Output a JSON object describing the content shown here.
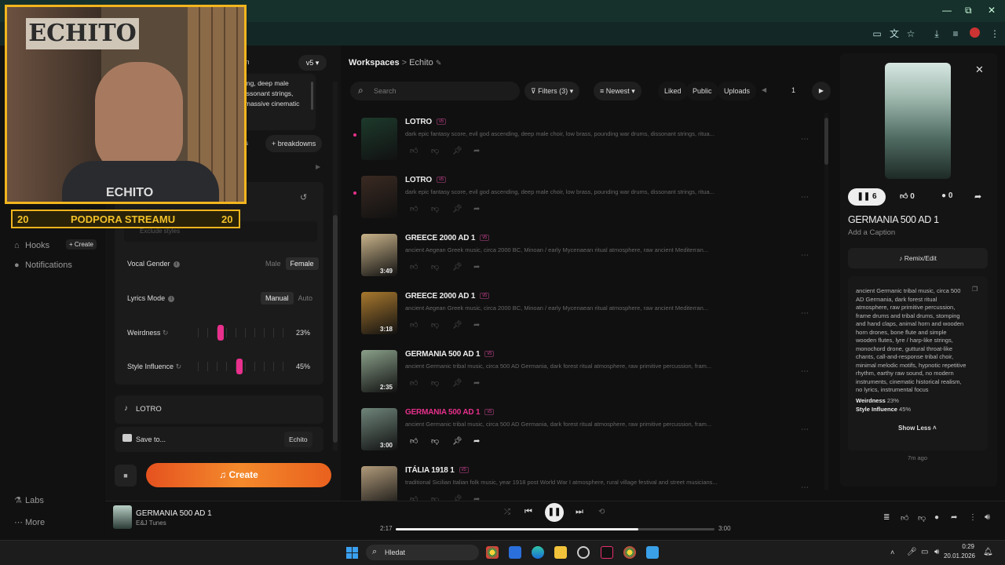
{
  "browser": {
    "window_controls": [
      "—",
      "⧉",
      "✕"
    ]
  },
  "overlay": {
    "webcam_logo": "ECHITO",
    "shirt_text": "ECHITO",
    "banner_left": "20",
    "banner_text": "PODPORA STREAMU",
    "banner_right": "20"
  },
  "leftnav": {
    "hooks": "Hooks",
    "create": "+ Create",
    "notifications": "Notifications",
    "labs": "Labs",
    "more": "More"
  },
  "form": {
    "version": "v5",
    "m_fragment": "m",
    "prompt_snippet": [
      "ing, deep male",
      "issonant strings,",
      "massive cinematic"
    ],
    "tag_chip_s": "s",
    "breakdowns": "+ breakdowns",
    "exclude_styles": "Exclude styles",
    "vocal_gender": "Vocal Gender",
    "male": "Male",
    "female": "Female",
    "lyrics_mode": "Lyrics Mode",
    "manual": "Manual",
    "auto": "Auto",
    "weirdness": "Weirdness",
    "weirdness_val": "23%",
    "weirdness_level": 0.23,
    "style_influence": "Style Influence",
    "style_val": "45%",
    "style_level": 0.45,
    "song_title": "LOTRO",
    "save_to": "Save to...",
    "workspace": "Echito",
    "create": "Create"
  },
  "main": {
    "breadcrumb_root": "Workspaces",
    "breadcrumb_sep": ">",
    "breadcrumb_current": "Echito",
    "search_placeholder": "Search",
    "filters": "Filters (3)",
    "sort": "Newest",
    "liked": "Liked",
    "public": "Public",
    "uploads": "Uploads",
    "page": "1",
    "songs": [
      {
        "title": "LOTRO",
        "badge": "v5",
        "desc": "dark epic fantasy score, evil god ascending, deep male choir, low brass, pounding war drums, dissonant strings, ritua...",
        "dur": "",
        "playing": false,
        "new": true
      },
      {
        "title": "LOTRO",
        "badge": "v5",
        "desc": "dark epic fantasy score, evil god ascending, deep male choir, low brass, pounding war drums, dissonant strings, ritua...",
        "dur": "",
        "playing": false,
        "new": true
      },
      {
        "title": "GREECE 2000 AD 1",
        "badge": "v5",
        "desc": "ancient Aegean Greek music, circa 2000 BC, Minoan / early Mycenaean ritual atmosphere, raw ancient Mediterran...",
        "dur": "3:49",
        "playing": false,
        "new": false
      },
      {
        "title": "GREECE 2000 AD 1",
        "badge": "v5",
        "desc": "ancient Aegean Greek music, circa 2000 BC, Minoan / early Mycenaean ritual atmosphere, raw ancient Mediterran...",
        "dur": "3:18",
        "playing": false,
        "new": false
      },
      {
        "title": "GERMANIA 500 AD 1",
        "badge": "v5",
        "desc": "ancient Germanic tribal music, circa 500 AD Germania, dark forest ritual atmosphere, raw primitive percussion, fram...",
        "dur": "2:35",
        "playing": false,
        "new": false
      },
      {
        "title": "GERMANIA 500 AD 1",
        "badge": "v5",
        "desc": "ancient Germanic tribal music, circa 500 AD Germania, dark forest ritual atmosphere, raw primitive percussion, fram...",
        "dur": "3:00",
        "playing": true,
        "new": false
      },
      {
        "title": "ITÁLIA 1918 1",
        "badge": "v5",
        "desc": "traditional Sicilian Italian folk music, year 1918 post World War I atmosphere, rural village festival and street musicians...",
        "dur": "",
        "playing": false,
        "new": false
      }
    ]
  },
  "detail": {
    "plays": "6",
    "likes": "0",
    "comments": "0",
    "title": "GERMANIA 500 AD 1",
    "caption": "Add a Caption",
    "remix": "Remix/Edit",
    "lyrics": "ancient Germanic tribal music, circa 500 AD Germania, dark forest ritual atmosphere, raw primitive percussion, frame drums and tribal drums, stomping and hand claps, animal horn and wooden horn drones, bone flute and simple wooden flutes, lyre / harp-like strings, monochord drone, guttural throat-like chants, call-and-response tribal choir, minimal melodic motifs, hypnotic repetitive rhythm, earthy raw sound, no modern instruments, cinematic historical realism, no lyrics, instrumental focus",
    "weirdness_label": "Weirdness",
    "weirdness_val": "23%",
    "style_label": "Style Influence",
    "style_val": "45%",
    "show_less": "Show Less",
    "ago": "7m ago"
  },
  "player": {
    "title": "GERMANIA 500 AD 1",
    "artist": "E&J Tunes",
    "elapsed": "2:17",
    "total": "3:00",
    "progress": 0.76
  },
  "taskbar": {
    "search": "Hledat",
    "time": "0:29",
    "date": "20.01.2026"
  },
  "colors": {
    "accent": "#e8308c",
    "create_gradient": "#f07a2a",
    "overlay_gold": "#f2b51e"
  }
}
